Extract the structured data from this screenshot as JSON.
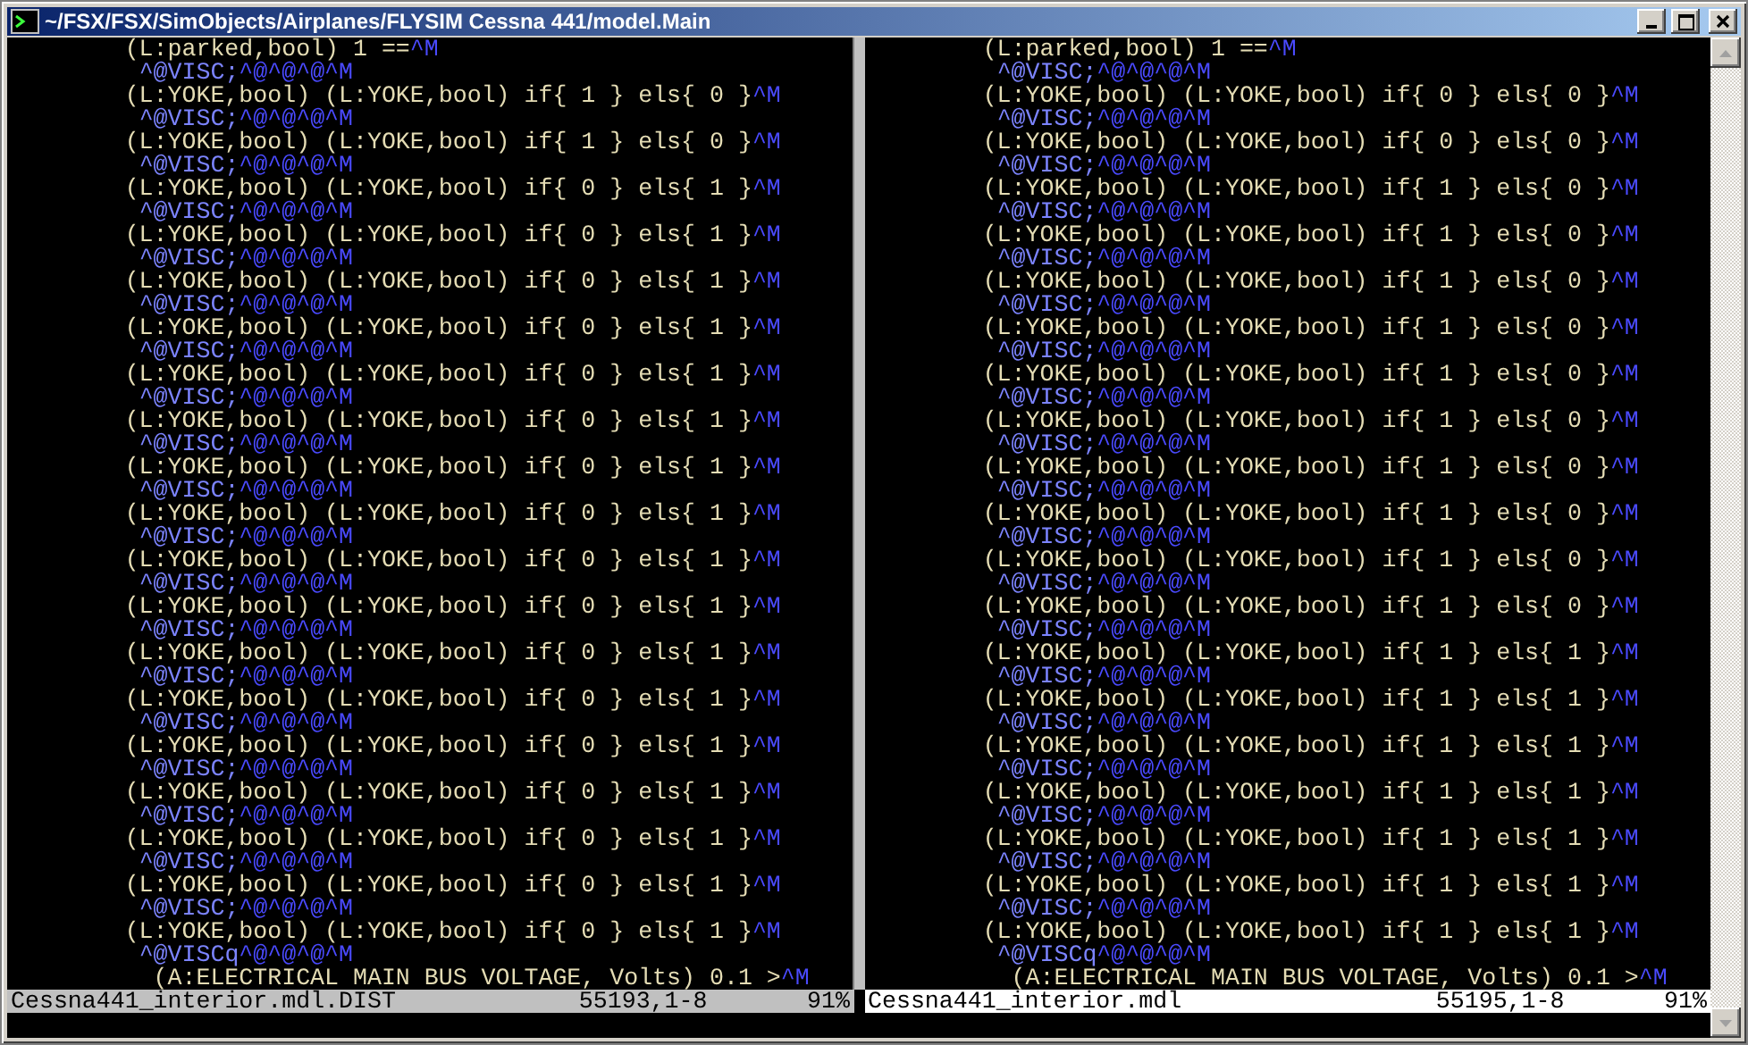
{
  "window": {
    "title": "~/FSX/FSX/SimObjects/Airplanes/FLYSIM Cessna 441/model.Main"
  },
  "panes": [
    {
      "lines": [
        {
          "kind": "expr",
          "text": "(L:parked,bool) 1 ==",
          "tail": "^M"
        },
        {
          "kind": "data",
          "text": "^@VISC;",
          "tail": "^@^@^@^M"
        },
        {
          "kind": "expr",
          "text": "(L:YOKE,bool) (L:YOKE,bool) if{ 1 } els{ 0 }",
          "tail": "^M"
        },
        {
          "kind": "data",
          "text": "^@VISC;",
          "tail": "^@^@^@^M"
        },
        {
          "kind": "expr",
          "text": "(L:YOKE,bool) (L:YOKE,bool) if{ 1 } els{ 0 }",
          "tail": "^M"
        },
        {
          "kind": "data",
          "text": "^@VISC;",
          "tail": "^@^@^@^M"
        },
        {
          "kind": "expr",
          "text": "(L:YOKE,bool) (L:YOKE,bool) if{ 0 } els{ 1 }",
          "tail": "^M"
        },
        {
          "kind": "data",
          "text": "^@VISC;",
          "tail": "^@^@^@^M"
        },
        {
          "kind": "expr",
          "text": "(L:YOKE,bool) (L:YOKE,bool) if{ 0 } els{ 1 }",
          "tail": "^M"
        },
        {
          "kind": "data",
          "text": "^@VISC;",
          "tail": "^@^@^@^M"
        },
        {
          "kind": "expr",
          "text": "(L:YOKE,bool) (L:YOKE,bool) if{ 0 } els{ 1 }",
          "tail": "^M"
        },
        {
          "kind": "data",
          "text": "^@VISC;",
          "tail": "^@^@^@^M"
        },
        {
          "kind": "expr",
          "text": "(L:YOKE,bool) (L:YOKE,bool) if{ 0 } els{ 1 }",
          "tail": "^M"
        },
        {
          "kind": "data",
          "text": "^@VISC;",
          "tail": "^@^@^@^M"
        },
        {
          "kind": "expr",
          "text": "(L:YOKE,bool) (L:YOKE,bool) if{ 0 } els{ 1 }",
          "tail": "^M"
        },
        {
          "kind": "data",
          "text": "^@VISC;",
          "tail": "^@^@^@^M"
        },
        {
          "kind": "expr",
          "text": "(L:YOKE,bool) (L:YOKE,bool) if{ 0 } els{ 1 }",
          "tail": "^M"
        },
        {
          "kind": "data",
          "text": "^@VISC;",
          "tail": "^@^@^@^M"
        },
        {
          "kind": "expr",
          "text": "(L:YOKE,bool) (L:YOKE,bool) if{ 0 } els{ 1 }",
          "tail": "^M"
        },
        {
          "kind": "data",
          "text": "^@VISC;",
          "tail": "^@^@^@^M"
        },
        {
          "kind": "expr",
          "text": "(L:YOKE,bool) (L:YOKE,bool) if{ 0 } els{ 1 }",
          "tail": "^M"
        },
        {
          "kind": "data",
          "text": "^@VISC;",
          "tail": "^@^@^@^M"
        },
        {
          "kind": "expr",
          "text": "(L:YOKE,bool) (L:YOKE,bool) if{ 0 } els{ 1 }",
          "tail": "^M"
        },
        {
          "kind": "data",
          "text": "^@VISC;",
          "tail": "^@^@^@^M"
        },
        {
          "kind": "expr",
          "text": "(L:YOKE,bool) (L:YOKE,bool) if{ 0 } els{ 1 }",
          "tail": "^M"
        },
        {
          "kind": "data",
          "text": "^@VISC;",
          "tail": "^@^@^@^M"
        },
        {
          "kind": "expr",
          "text": "(L:YOKE,bool) (L:YOKE,bool) if{ 0 } els{ 1 }",
          "tail": "^M"
        },
        {
          "kind": "data",
          "text": "^@VISC;",
          "tail": "^@^@^@^M"
        },
        {
          "kind": "expr",
          "text": "(L:YOKE,bool) (L:YOKE,bool) if{ 0 } els{ 1 }",
          "tail": "^M"
        },
        {
          "kind": "data",
          "text": "^@VISC;",
          "tail": "^@^@^@^M"
        },
        {
          "kind": "expr",
          "text": "(L:YOKE,bool) (L:YOKE,bool) if{ 0 } els{ 1 }",
          "tail": "^M"
        },
        {
          "kind": "data",
          "text": "^@VISC;",
          "tail": "^@^@^@^M"
        },
        {
          "kind": "expr",
          "text": "(L:YOKE,bool) (L:YOKE,bool) if{ 0 } els{ 1 }",
          "tail": "^M"
        },
        {
          "kind": "data",
          "text": "^@VISC;",
          "tail": "^@^@^@^M"
        },
        {
          "kind": "expr",
          "text": "(L:YOKE,bool) (L:YOKE,bool) if{ 0 } els{ 1 }",
          "tail": "^M"
        },
        {
          "kind": "data",
          "text": "^@VISC;",
          "tail": "^@^@^@^M"
        },
        {
          "kind": "expr",
          "text": "(L:YOKE,bool) (L:YOKE,bool) if{ 0 } els{ 1 }",
          "tail": "^M"
        },
        {
          "kind": "data",
          "text": "^@VISC;",
          "tail": "^@^@^@^M"
        },
        {
          "kind": "expr",
          "text": "(L:YOKE,bool) (L:YOKE,bool) if{ 0 } els{ 1 }",
          "tail": "^M"
        },
        {
          "kind": "data",
          "text": "^@VISCq",
          "tail": "^@^@^@^M"
        },
        {
          "kind": "nested",
          "text": "(A:ELECTRICAL MAIN BUS VOLTAGE, Volts) 0.1 >",
          "tail": "^M"
        }
      ],
      "status": {
        "file": "Cessna441_interior.mdl.DIST",
        "position": "55193,1-8",
        "percent": "91%",
        "active": false
      }
    },
    {
      "lines": [
        {
          "kind": "expr",
          "text": "(L:parked,bool) 1 ==",
          "tail": "^M"
        },
        {
          "kind": "data",
          "text": "^@VISC;",
          "tail": "^@^@^@^M"
        },
        {
          "kind": "expr",
          "text": "(L:YOKE,bool) (L:YOKE,bool) if{ 0 } els{ 0 }",
          "tail": "^M"
        },
        {
          "kind": "data",
          "text": "^@VISC;",
          "tail": "^@^@^@^M"
        },
        {
          "kind": "expr",
          "text": "(L:YOKE,bool) (L:YOKE,bool) if{ 0 } els{ 0 }",
          "tail": "^M"
        },
        {
          "kind": "data",
          "text": "^@VISC;",
          "tail": "^@^@^@^M"
        },
        {
          "kind": "expr",
          "text": "(L:YOKE,bool) (L:YOKE,bool) if{ 1 } els{ 0 }",
          "tail": "^M"
        },
        {
          "kind": "data",
          "text": "^@VISC;",
          "tail": "^@^@^@^M"
        },
        {
          "kind": "expr",
          "text": "(L:YOKE,bool) (L:YOKE,bool) if{ 1 } els{ 0 }",
          "tail": "^M"
        },
        {
          "kind": "data",
          "text": "^@VISC;",
          "tail": "^@^@^@^M"
        },
        {
          "kind": "expr",
          "text": "(L:YOKE,bool) (L:YOKE,bool) if{ 1 } els{ 0 }",
          "tail": "^M"
        },
        {
          "kind": "data",
          "text": "^@VISC;",
          "tail": "^@^@^@^M"
        },
        {
          "kind": "expr",
          "text": "(L:YOKE,bool) (L:YOKE,bool) if{ 1 } els{ 0 }",
          "tail": "^M"
        },
        {
          "kind": "data",
          "text": "^@VISC;",
          "tail": "^@^@^@^M"
        },
        {
          "kind": "expr",
          "text": "(L:YOKE,bool) (L:YOKE,bool) if{ 1 } els{ 0 }",
          "tail": "^M"
        },
        {
          "kind": "data",
          "text": "^@VISC;",
          "tail": "^@^@^@^M"
        },
        {
          "kind": "expr",
          "text": "(L:YOKE,bool) (L:YOKE,bool) if{ 1 } els{ 0 }",
          "tail": "^M"
        },
        {
          "kind": "data",
          "text": "^@VISC;",
          "tail": "^@^@^@^M"
        },
        {
          "kind": "expr",
          "text": "(L:YOKE,bool) (L:YOKE,bool) if{ 1 } els{ 0 }",
          "tail": "^M"
        },
        {
          "kind": "data",
          "text": "^@VISC;",
          "tail": "^@^@^@^M"
        },
        {
          "kind": "expr",
          "text": "(L:YOKE,bool) (L:YOKE,bool) if{ 1 } els{ 0 }",
          "tail": "^M"
        },
        {
          "kind": "data",
          "text": "^@VISC;",
          "tail": "^@^@^@^M"
        },
        {
          "kind": "expr",
          "text": "(L:YOKE,bool) (L:YOKE,bool) if{ 1 } els{ 0 }",
          "tail": "^M"
        },
        {
          "kind": "data",
          "text": "^@VISC;",
          "tail": "^@^@^@^M"
        },
        {
          "kind": "expr",
          "text": "(L:YOKE,bool) (L:YOKE,bool) if{ 1 } els{ 0 }",
          "tail": "^M"
        },
        {
          "kind": "data",
          "text": "^@VISC;",
          "tail": "^@^@^@^M"
        },
        {
          "kind": "expr",
          "text": "(L:YOKE,bool) (L:YOKE,bool) if{ 1 } els{ 1 }",
          "tail": "^M"
        },
        {
          "kind": "data",
          "text": "^@VISC;",
          "tail": "^@^@^@^M"
        },
        {
          "kind": "expr",
          "text": "(L:YOKE,bool) (L:YOKE,bool) if{ 1 } els{ 1 }",
          "tail": "^M"
        },
        {
          "kind": "data",
          "text": "^@VISC;",
          "tail": "^@^@^@^M"
        },
        {
          "kind": "expr",
          "text": "(L:YOKE,bool) (L:YOKE,bool) if{ 1 } els{ 1 }",
          "tail": "^M"
        },
        {
          "kind": "data",
          "text": "^@VISC;",
          "tail": "^@^@^@^M"
        },
        {
          "kind": "expr",
          "text": "(L:YOKE,bool) (L:YOKE,bool) if{ 1 } els{ 1 }",
          "tail": "^M"
        },
        {
          "kind": "data",
          "text": "^@VISC;",
          "tail": "^@^@^@^M"
        },
        {
          "kind": "expr",
          "text": "(L:YOKE,bool) (L:YOKE,bool) if{ 1 } els{ 1 }",
          "tail": "^M"
        },
        {
          "kind": "data",
          "text": "^@VISC;",
          "tail": "^@^@^@^M"
        },
        {
          "kind": "expr",
          "text": "(L:YOKE,bool) (L:YOKE,bool) if{ 1 } els{ 1 }",
          "tail": "^M"
        },
        {
          "kind": "data",
          "text": "^@VISC;",
          "tail": "^@^@^@^M"
        },
        {
          "kind": "expr",
          "text": "(L:YOKE,bool) (L:YOKE,bool) if{ 1 } els{ 1 }",
          "tail": "^M"
        },
        {
          "kind": "data",
          "text": "^@VISCq",
          "tail": "^@^@^@^M"
        },
        {
          "kind": "nested",
          "text": "(A:ELECTRICAL MAIN BUS VOLTAGE, Volts) 0.1 >",
          "tail": "^M"
        }
      ],
      "status": {
        "file": "Cessna441_interior.mdl",
        "position": "55195,1-8",
        "percent": "91%",
        "active": true
      }
    }
  ]
}
